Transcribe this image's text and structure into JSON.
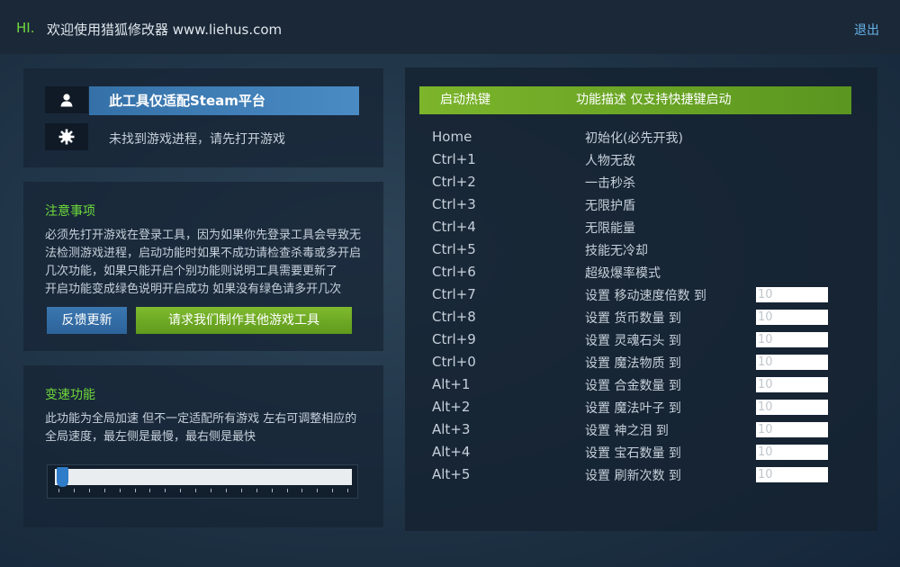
{
  "header": {
    "greeting": "HI.",
    "welcome": "欢迎使用猎狐修改器 www.liehus.com",
    "logout_label": "退出"
  },
  "platform": {
    "title": "此工具仅适配Steam平台",
    "status": "未找到游戏进程，请先打开游戏",
    "icons": [
      "user-icon",
      "gear-icon"
    ]
  },
  "notice": {
    "title": "注意事项",
    "lines": [
      "必须先打开游戏在登录工具，因为如果你先登录工具会导致无",
      "法检测游戏进程，启动功能时如果不成功请检查杀毒或多开启",
      "几次功能，如果只能开启个别功能则说明工具需要更新了",
      "开启功能变成绿色说明开启成功 如果没有绿色请多开几次"
    ],
    "feedback_label": "反馈更新",
    "request_label": "请求我们制作其他游戏工具"
  },
  "speed": {
    "title": "变速功能",
    "lines": [
      "此功能为全局加速 但不一定适配所有游戏 左右可调整相应的",
      "全局速度，最左侧是最慢，最右侧是最快"
    ],
    "value": 0
  },
  "hotkeys": {
    "col_key": "启动热键",
    "col_desc": "功能描述 仅支持快捷键启动",
    "rows": [
      {
        "key": "Home",
        "desc": "初始化(必先开我)"
      },
      {
        "key": "Ctrl+1",
        "desc": "人物无敌"
      },
      {
        "key": "Ctrl+2",
        "desc": "一击秒杀"
      },
      {
        "key": "Ctrl+3",
        "desc": "无限护盾"
      },
      {
        "key": "Ctrl+4",
        "desc": "无限能量"
      },
      {
        "key": "Ctrl+5",
        "desc": "技能无冷却"
      },
      {
        "key": "Ctrl+6",
        "desc": "超级爆率模式"
      },
      {
        "key": "Ctrl+7",
        "desc": "设置 移动速度倍数 到",
        "value": "10"
      },
      {
        "key": "Ctrl+8",
        "desc": "设置 货币数量 到",
        "value": "10"
      },
      {
        "key": "Ctrl+9",
        "desc": "设置 灵魂石头 到",
        "value": "10"
      },
      {
        "key": "Ctrl+0",
        "desc": "设置 魔法物质 到",
        "value": "10"
      },
      {
        "key": "Alt+1",
        "desc": "设置 合金数量 到",
        "value": "10"
      },
      {
        "key": "Alt+2",
        "desc": "设置 魔法叶子 到",
        "value": "10"
      },
      {
        "key": "Alt+3",
        "desc": "设置 神之泪 到",
        "value": "10"
      },
      {
        "key": "Alt+4",
        "desc": "设置 宝石数量 到",
        "value": "10"
      },
      {
        "key": "Alt+5",
        "desc": "设置 刷新次数 到",
        "value": "10"
      }
    ]
  }
}
